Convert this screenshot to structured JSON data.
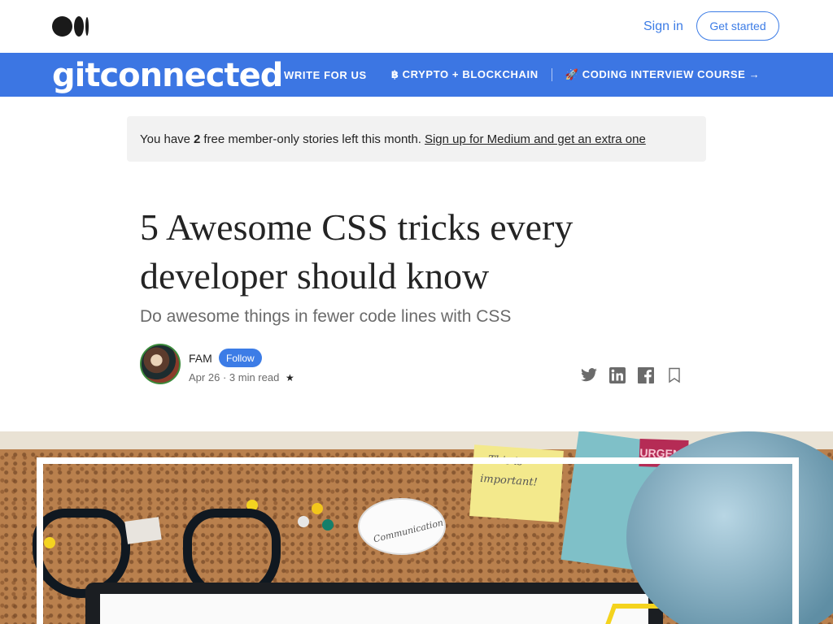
{
  "topbar": {
    "signin_label": "Sign in",
    "getstarted_label": "Get started"
  },
  "publication": {
    "brand": "gitconnected",
    "nav": [
      {
        "label": "WRITE FOR US"
      },
      {
        "label": "฿ CRYPTO + BLOCKCHAIN"
      },
      {
        "label": "🚀 CODING INTERVIEW COURSE →"
      }
    ]
  },
  "banner": {
    "prefix": "You have",
    "count": "2",
    "suffix": "free member-only stories left this month.",
    "link": "Sign up for Medium and get an extra one"
  },
  "article": {
    "title": "5 Awesome CSS tricks every developer should know",
    "subtitle": "Do awesome things in fewer code lines with CSS",
    "author": "FAM",
    "follow_label": "Follow",
    "date": "Apr 26",
    "read_time": "3 min read",
    "star": "★"
  },
  "hero": {
    "note_line1": "This is",
    "note_line2": "important!",
    "bubble_text": "Communication",
    "urgent": "URGENT"
  },
  "icons": {
    "twitter": "twitter-icon",
    "linkedin": "linkedin-icon",
    "facebook": "facebook-icon",
    "bookmark": "bookmark-icon"
  },
  "colors": {
    "accent": "#3c7ce6",
    "nav_bg": "#3c76e3",
    "banner_bg": "#f2f2f2"
  }
}
